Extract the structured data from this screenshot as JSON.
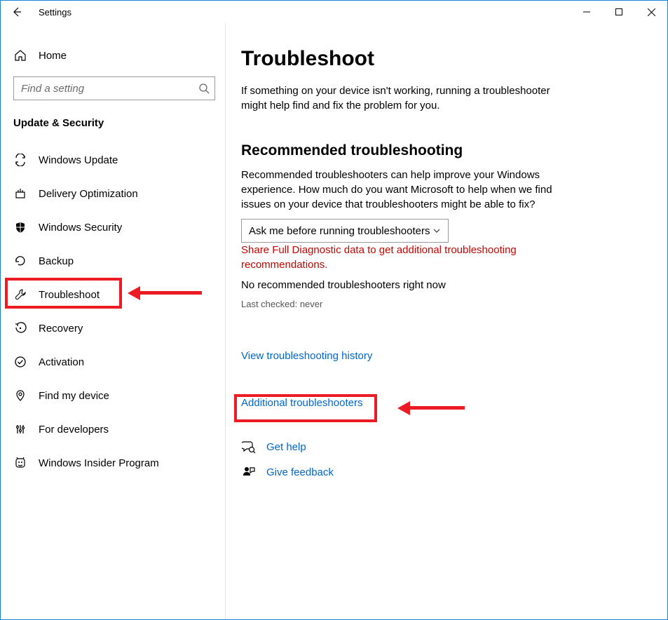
{
  "window": {
    "title": "Settings"
  },
  "sidebar": {
    "home_label": "Home",
    "search_placeholder": "Find a setting",
    "section_label": "Update & Security",
    "items": [
      {
        "label": "Windows Update"
      },
      {
        "label": "Delivery Optimization"
      },
      {
        "label": "Windows Security"
      },
      {
        "label": "Backup"
      },
      {
        "label": "Troubleshoot",
        "active": true
      },
      {
        "label": "Recovery"
      },
      {
        "label": "Activation"
      },
      {
        "label": "Find my device"
      },
      {
        "label": "For developers"
      },
      {
        "label": "Windows Insider Program"
      }
    ]
  },
  "content": {
    "title": "Troubleshoot",
    "intro": "If something on your device isn't working, running a troubleshooter might help find and fix the problem for you.",
    "rec_heading": "Recommended troubleshooting",
    "rec_desc": "Recommended troubleshooters can help improve your Windows experience. How much do you want Microsoft to help when we find issues on your device that troubleshooters might be able to fix?",
    "dropdown_value": "Ask me before running troubleshooters",
    "diag_warning": "Share Full Diagnostic data to get additional troubleshooting recommendations.",
    "no_rec": "No recommended troubleshooters right now",
    "last_checked": "Last checked: never",
    "history_link": "View troubleshooting history",
    "additional_link": "Additional troubleshooters",
    "get_help": "Get help",
    "give_feedback": "Give feedback"
  }
}
